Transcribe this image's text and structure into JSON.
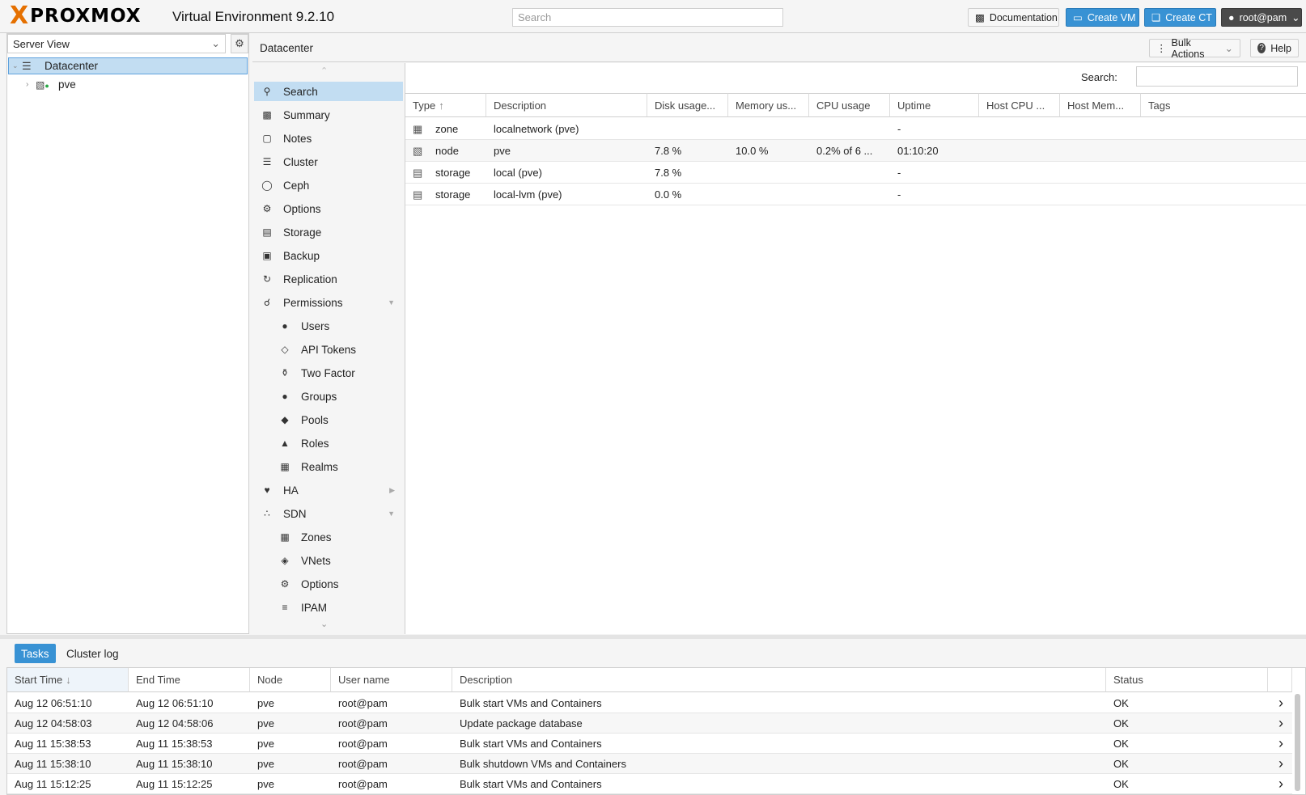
{
  "header": {
    "brand": "PROXMOX",
    "version": "Virtual Environment 9.2.10",
    "search_placeholder": "Search",
    "documentation": "Documentation",
    "create_vm": "Create VM",
    "create_ct": "Create CT",
    "user": "root@pam"
  },
  "tree": {
    "view": "Server View",
    "items": [
      {
        "label": "Datacenter"
      },
      {
        "label": "pve"
      }
    ]
  },
  "content": {
    "breadcrumb": "Datacenter",
    "bulk_actions": "Bulk Actions",
    "help": "Help",
    "search_label": "Search:"
  },
  "menu": [
    {
      "label": "Search",
      "icon": "search-icon"
    },
    {
      "label": "Summary",
      "icon": "book-icon"
    },
    {
      "label": "Notes",
      "icon": "note-icon"
    },
    {
      "label": "Cluster",
      "icon": "server-icon"
    },
    {
      "label": "Ceph",
      "icon": "ceph-icon"
    },
    {
      "label": "Options",
      "icon": "gear-icon"
    },
    {
      "label": "Storage",
      "icon": "database-icon"
    },
    {
      "label": "Backup",
      "icon": "floppy-icon"
    },
    {
      "label": "Replication",
      "icon": "retweet-icon"
    },
    {
      "label": "Permissions",
      "icon": "unlock-icon"
    },
    {
      "label": "Users",
      "icon": "user-icon"
    },
    {
      "label": "API Tokens",
      "icon": "lock-icon"
    },
    {
      "label": "Two Factor",
      "icon": "key-icon"
    },
    {
      "label": "Groups",
      "icon": "users-icon"
    },
    {
      "label": "Pools",
      "icon": "tags-icon"
    },
    {
      "label": "Roles",
      "icon": "male-icon"
    },
    {
      "label": "Realms",
      "icon": "address-book-icon"
    },
    {
      "label": "HA",
      "icon": "heartbeat-icon"
    },
    {
      "label": "SDN",
      "icon": "sdn-icon"
    },
    {
      "label": "Zones",
      "icon": "grid-icon"
    },
    {
      "label": "VNets",
      "icon": "network-icon"
    },
    {
      "label": "Options",
      "icon": "gear-icon"
    },
    {
      "label": "IPAM",
      "icon": "ipam-icon"
    }
  ],
  "grid": {
    "columns": [
      "Type",
      "Description",
      "Disk usage...",
      "Memory us...",
      "CPU usage",
      "Uptime",
      "Host CPU ...",
      "Host Mem...",
      "Tags"
    ],
    "rows": [
      [
        "zone",
        "localnetwork (pve)",
        "",
        "",
        "",
        "-",
        "",
        "",
        ""
      ],
      [
        "node",
        "pve",
        "7.8 %",
        "10.0 %",
        "0.2% of 6 ...",
        "01:10:20",
        "",
        "",
        ""
      ],
      [
        "storage",
        "local (pve)",
        "7.8 %",
        "",
        "",
        "-",
        "",
        "",
        ""
      ],
      [
        "storage",
        "local-lvm (pve)",
        "0.0 %",
        "",
        "",
        "-",
        "",
        "",
        ""
      ]
    ]
  },
  "tasks": {
    "tabs": [
      "Tasks",
      "Cluster log"
    ],
    "columns": [
      "Start Time",
      "End Time",
      "Node",
      "User name",
      "Description",
      "Status"
    ],
    "rows": [
      [
        "Aug 12 06:51:10",
        "Aug 12 06:51:10",
        "pve",
        "root@pam",
        "Bulk start VMs and Containers",
        "OK"
      ],
      [
        "Aug 12 04:58:03",
        "Aug 12 04:58:06",
        "pve",
        "root@pam",
        "Update package database",
        "OK"
      ],
      [
        "Aug 11 15:38:53",
        "Aug 11 15:38:53",
        "pve",
        "root@pam",
        "Bulk start VMs and Containers",
        "OK"
      ],
      [
        "Aug 11 15:38:10",
        "Aug 11 15:38:10",
        "pve",
        "root@pam",
        "Bulk shutdown VMs and Containers",
        "OK"
      ],
      [
        "Aug 11 15:12:25",
        "Aug 11 15:12:25",
        "pve",
        "root@pam",
        "Bulk start VMs and Containers",
        "OK"
      ]
    ]
  }
}
